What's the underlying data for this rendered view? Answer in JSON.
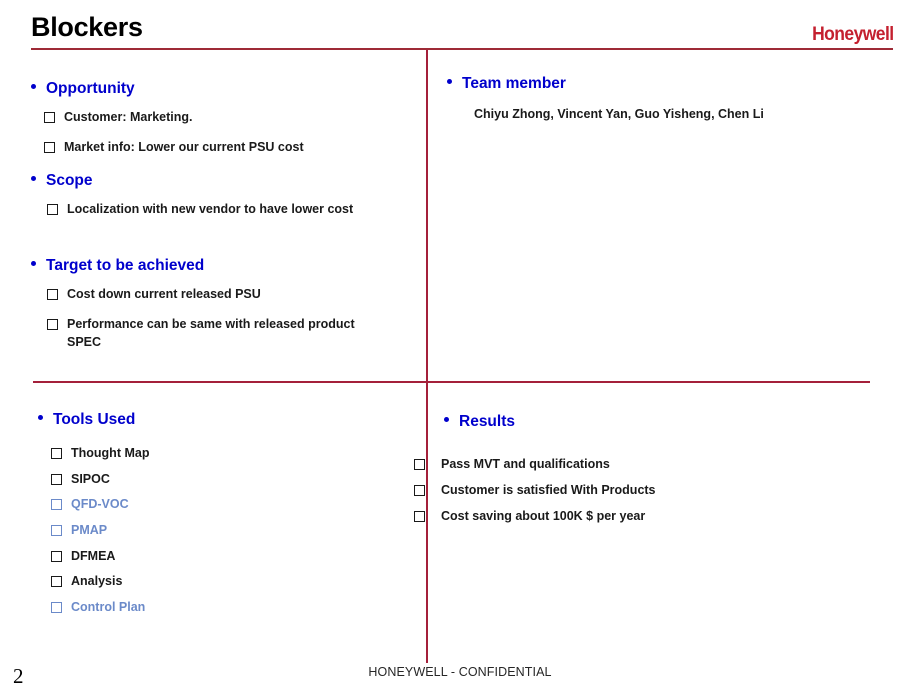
{
  "slide": {
    "title": "Blockers",
    "brand": "Honeywell",
    "page_number": "2",
    "footer": "HONEYWELL - CONFIDENTIAL",
    "accent_color": "#A4203A",
    "brand_color": "#C4202F",
    "heading_color": "#0000CC",
    "dim_color": "#6B8AC9"
  },
  "quadrants": {
    "top_left": {
      "sections": [
        {
          "heading": "Opportunity",
          "items": [
            {
              "label": "Customer: Marketing.",
              "dim": false
            },
            {
              "label": "Market info: Lower our current PSU cost",
              "dim": false
            }
          ]
        },
        {
          "heading": "Scope",
          "items": [
            {
              "label": "Localization  with new vendor to have lower cost",
              "dim": false
            }
          ]
        },
        {
          "heading": "Target to be achieved",
          "items": [
            {
              "label": "Cost down current released PSU",
              "dim": false
            },
            {
              "label": "Performance can be same with released product SPEC",
              "dim": false
            }
          ]
        }
      ]
    },
    "top_right": {
      "heading": "Team member",
      "members_line": "Chiyu Zhong,  Vincent Yan, Guo Yisheng, Chen Li"
    },
    "bottom_left": {
      "heading": "Tools Used",
      "items": [
        {
          "label": "Thought  Map",
          "dim": false
        },
        {
          "label": "SIPOC",
          "dim": false
        },
        {
          "label": "QFD-VOC",
          "dim": true
        },
        {
          "label": "PMAP",
          "dim": true
        },
        {
          "label": "DFMEA",
          "dim": false
        },
        {
          "label": "Analysis",
          "dim": false
        },
        {
          "label": "Control Plan",
          "dim": true
        }
      ]
    },
    "bottom_right": {
      "heading": "Results",
      "items": [
        {
          "label": "Pass MVT and qualifications",
          "dim": false
        },
        {
          "label": "Customer is satisfied With Products",
          "dim": false
        },
        {
          "label": "Cost saving about 100K $ per year",
          "dim": false
        }
      ]
    }
  }
}
